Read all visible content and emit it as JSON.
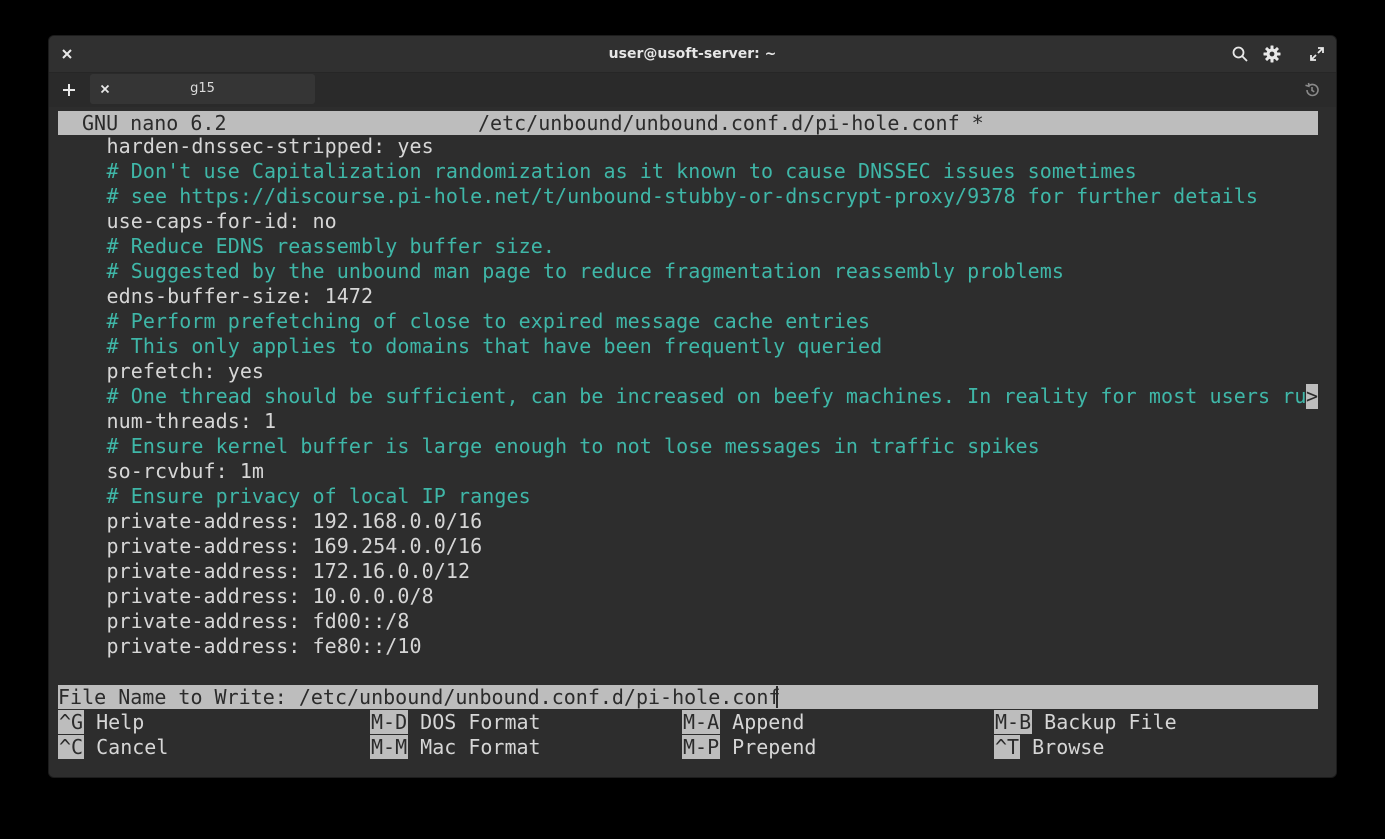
{
  "window": {
    "title": "user@usoft-server: ~",
    "icons": [
      "close-icon",
      "search-icon",
      "gear-icon",
      "maximize-icon"
    ]
  },
  "tabs": {
    "new_tab_icon": "plus-icon",
    "active": {
      "close_icon": "close-icon",
      "title": "g15"
    },
    "history_icon": "history-icon"
  },
  "nano": {
    "header_left": "GNU nano 6.2",
    "header_file": "/etc/unbound/unbound.conf.d/pi-hole.conf *",
    "lines": [
      {
        "text": "    harden-dnssec-stripped: yes",
        "kind": "code"
      },
      {
        "text": "    # Don't use Capitalization randomization as it known to cause DNSSEC issues sometimes",
        "kind": "comment"
      },
      {
        "text": "    # see https://discourse.pi-hole.net/t/unbound-stubby-or-dnscrypt-proxy/9378 for further details",
        "kind": "comment"
      },
      {
        "text": "    use-caps-for-id: no",
        "kind": "code"
      },
      {
        "text": "    # Reduce EDNS reassembly buffer size.",
        "kind": "comment"
      },
      {
        "text": "    # Suggested by the unbound man page to reduce fragmentation reassembly problems",
        "kind": "comment"
      },
      {
        "text": "    edns-buffer-size: 1472",
        "kind": "code"
      },
      {
        "text": "    # Perform prefetching of close to expired message cache entries",
        "kind": "comment"
      },
      {
        "text": "    # This only applies to domains that have been frequently queried",
        "kind": "comment"
      },
      {
        "text": "    prefetch: yes",
        "kind": "code"
      },
      {
        "text": "    # One thread should be sufficient, can be increased on beefy machines. In reality for most users run",
        "kind": "comment"
      },
      {
        "text": "    num-threads: 1",
        "kind": "code"
      },
      {
        "text": "    # Ensure kernel buffer is large enough to not lose messages in traffic spikes",
        "kind": "comment"
      },
      {
        "text": "    so-rcvbuf: 1m",
        "kind": "code"
      },
      {
        "text": "    # Ensure privacy of local IP ranges",
        "kind": "comment"
      },
      {
        "text": "    private-address: 192.168.0.0/16",
        "kind": "code"
      },
      {
        "text": "    private-address: 169.254.0.0/16",
        "kind": "code"
      },
      {
        "text": "    private-address: 172.16.0.0/12",
        "kind": "code"
      },
      {
        "text": "    private-address: 10.0.0.0/8",
        "kind": "code"
      },
      {
        "text": "    private-address: fd00::/8",
        "kind": "code"
      },
      {
        "text": "    private-address: fe80::/10",
        "kind": "code"
      }
    ],
    "overflow_marker": ">",
    "prompt_label": "File Name to Write: ",
    "prompt_value": "/etc/unbound/unbound.conf.d/pi-hole.conf",
    "shortcuts": [
      {
        "key": "^G",
        "label": "Help"
      },
      {
        "key": "M-D",
        "label": "DOS Format"
      },
      {
        "key": "M-A",
        "label": "Append"
      },
      {
        "key": "M-B",
        "label": "Backup File"
      },
      {
        "key": "^C",
        "label": "Cancel"
      },
      {
        "key": "M-M",
        "label": "Mac Format"
      },
      {
        "key": "M-P",
        "label": "Prepend"
      },
      {
        "key": "^T",
        "label": "Browse"
      }
    ]
  },
  "colors": {
    "comment": "#3fb7a8",
    "text": "#d6d6d6",
    "bar_bg": "#bdbdbd",
    "terminal_bg": "#2d2d2d"
  }
}
